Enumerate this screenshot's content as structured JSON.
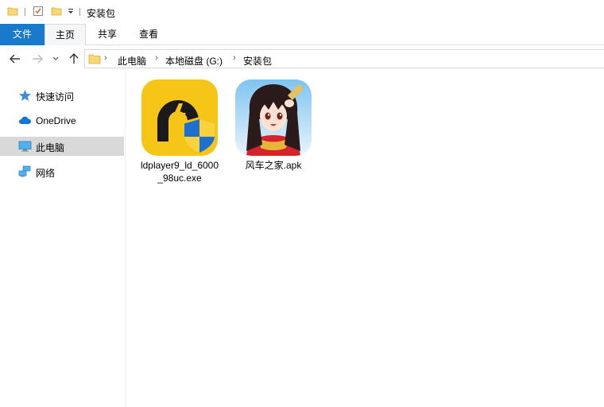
{
  "window": {
    "title": "安装包"
  },
  "ribbon": {
    "tabs": [
      {
        "label": "文件"
      },
      {
        "label": "主页"
      },
      {
        "label": "共享"
      },
      {
        "label": "查看"
      }
    ]
  },
  "address": {
    "crumbs": [
      "此电脑",
      "本地磁盘 (G:)",
      "安装包"
    ]
  },
  "navpane": {
    "items": [
      {
        "label": "快速访问"
      },
      {
        "label": "OneDrive"
      },
      {
        "label": "此电脑"
      },
      {
        "label": "网络"
      }
    ]
  },
  "files": [
    {
      "name": "ldplayer9_ld_6000_98uc.exe"
    },
    {
      "name": "风车之家.apk"
    }
  ],
  "colors": {
    "file_tab": "#1979ca",
    "selected_nav": "#d9d9d9",
    "ldplayer_yellow": "#f5c518",
    "shield_blue": "#1f6fd1"
  }
}
